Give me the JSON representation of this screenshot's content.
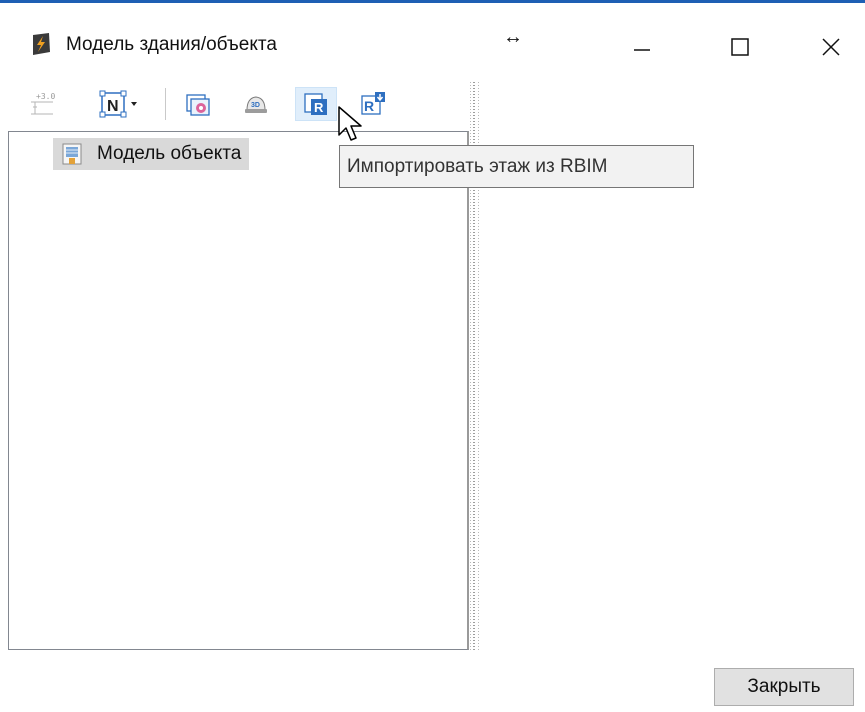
{
  "window": {
    "title": "Модель здания/объекта",
    "accent_color": "#1e5fb4",
    "icons": {
      "app": "app-lightning-icon",
      "resize": "resize-horizontal-icon",
      "minimize": "minimize-icon",
      "maximize": "maximize-icon",
      "close": "close-icon"
    },
    "resize_glyph": "↔"
  },
  "toolbar": {
    "buttons": [
      {
        "name": "level-elevation-button",
        "icon": "level-elevation-icon",
        "enabled": false
      },
      {
        "name": "north-dropdown-button",
        "icon": "north-arrow-icon",
        "has_dropdown": true
      },
      {
        "name": "layer-settings-button",
        "icon": "layer-settings-icon"
      },
      {
        "name": "3d-view-button",
        "icon": "3d-helmet-icon"
      },
      {
        "name": "import-floor-button",
        "icon": "import-floor-icon",
        "hovered": true
      },
      {
        "name": "export-rbim-button",
        "icon": "export-rbim-icon"
      }
    ]
  },
  "tree": {
    "items": [
      {
        "label": "Модель объекта",
        "icon": "building-icon",
        "selected": true
      }
    ]
  },
  "tooltip": {
    "text": "Импортировать этаж из RBIM"
  },
  "footer": {
    "close_label": "Закрыть"
  }
}
